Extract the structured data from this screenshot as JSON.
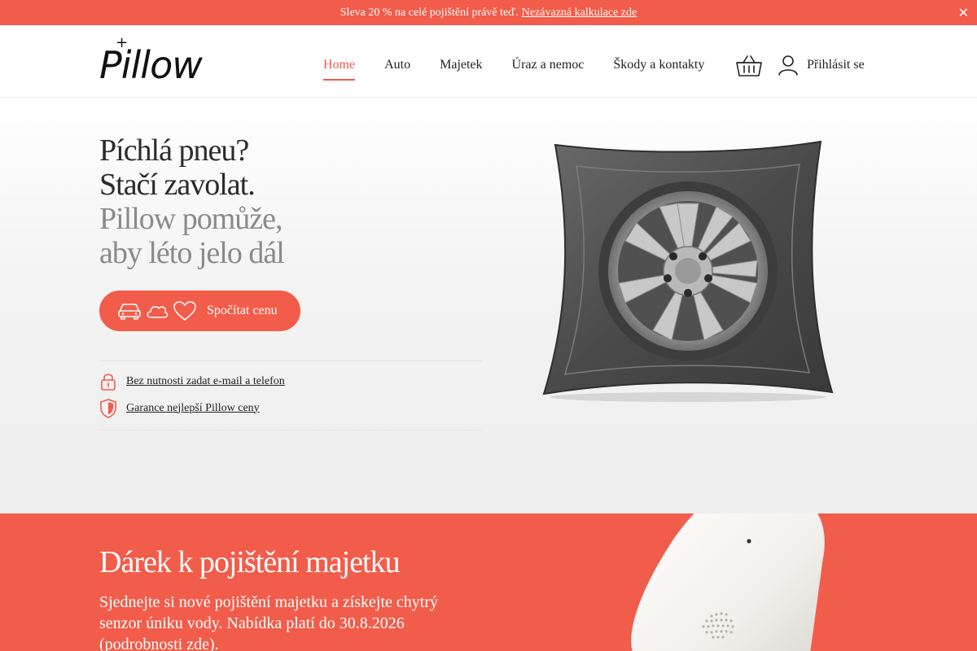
{
  "promo": {
    "text": "Sleva 20 % na celé pojištění právě teď.",
    "link": "Nezávazná kalkulace zde",
    "close": "✕"
  },
  "header": {
    "logo_plus": "+",
    "logo_text": "Pillow",
    "nav": [
      {
        "label": "Home",
        "active": true
      },
      {
        "label": "Auto",
        "active": false
      },
      {
        "label": "Majetek",
        "active": false
      },
      {
        "label": "Úraz a nemoc",
        "active": false
      },
      {
        "label": "Škody a kontakty",
        "active": false
      }
    ],
    "cart_icon": "basket-icon",
    "login_icon": "user-icon",
    "login_label": "Přihlásit se"
  },
  "hero": {
    "line1": "Píchlá pneu?",
    "line2": "Stačí zavolat.",
    "line3": "Pillow pomůže,",
    "line4": "aby léto jelo dál",
    "cta_icons": [
      "car-icon",
      "cloud-icon",
      "heart-icon"
    ],
    "cta_label": "Spočítat cenu",
    "benefits": [
      {
        "icon": "lock-icon",
        "label": "Bez nutnosti zadat e-mail a telefon"
      },
      {
        "icon": "shield-icon",
        "label": "Garance nejlepší Pillow ceny"
      }
    ]
  },
  "gift": {
    "title": "Dárek k pojištění majetku",
    "text": "Sjednejte si nové pojištění majetku a získejte chytrý senzor úniku vody. Nabídka platí do 30.8.2026 (podrobnosti zde)."
  },
  "colors": {
    "accent": "#f25c4a",
    "hero_grey": "#8a8a8a"
  }
}
